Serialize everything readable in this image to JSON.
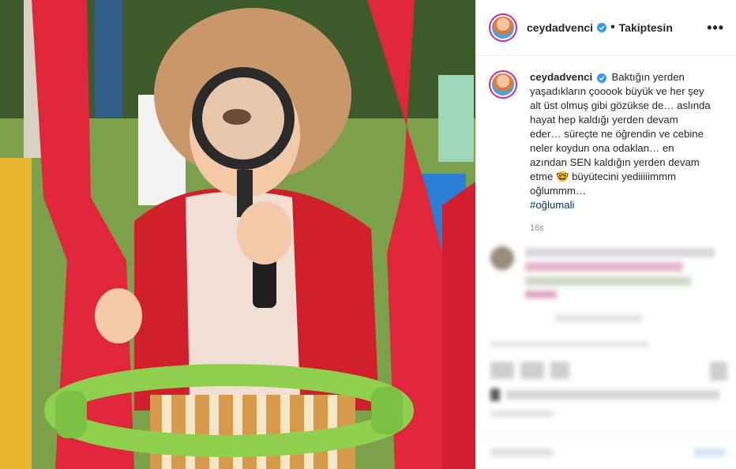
{
  "post": {
    "username": "ceydadvenci",
    "separator": "•",
    "follow_status": "Takiptesin",
    "more_label": "•••",
    "caption_text": "Baktığın yerden yaşadıkların çooook büyük ve her şey alt üst olmuş gibi gözükse de… aslında hayat hep kaldığı yerden devam eder… süreçte ne öğrendin ve cebine neler koydun ona odaklan… en azından SEN kaldığın yerden devam etme 🤓 büyütecini yediiiiimmm oğlummm…",
    "hashtag": "#oğlumali",
    "age": "16s"
  },
  "colors": {
    "accent_link": "#00376b",
    "verified_blue": "#3897f0",
    "muted": "#8e8e8e"
  },
  "icons": {
    "verified": "verified-badge-icon",
    "more": "more-options-icon"
  }
}
